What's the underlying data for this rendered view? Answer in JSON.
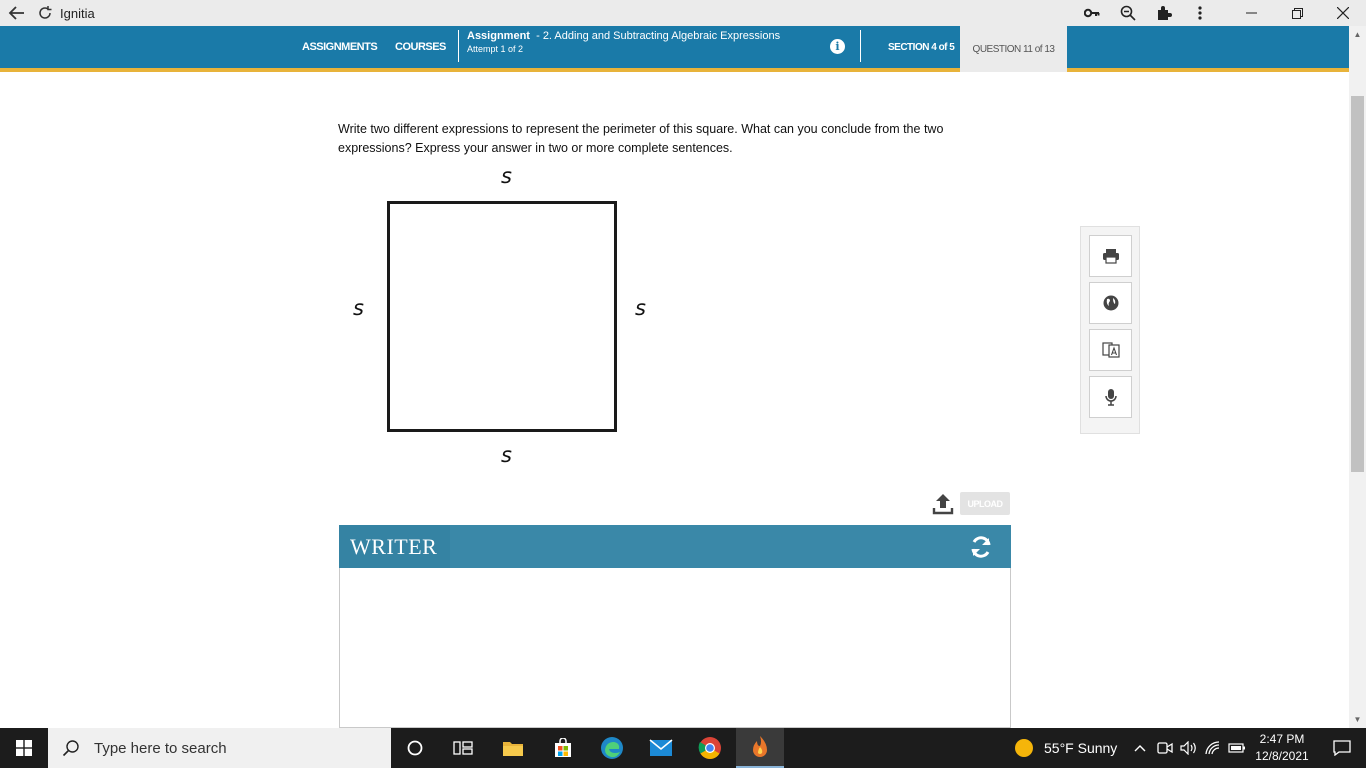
{
  "browser": {
    "title": "Ignitia",
    "icons": [
      "back-arrow-icon",
      "refresh-icon",
      "key-icon",
      "zoom-icon",
      "extensions-icon",
      "more-vert-icon",
      "minimize-icon",
      "restore-icon",
      "close-icon"
    ]
  },
  "header": {
    "nav": [
      "ASSIGNMENTS",
      "COURSES"
    ],
    "assignment_label": "Assignment",
    "assignment_title": "- 2. Adding and Subtracting Algebraic Expressions",
    "attempt": "Attempt 1 of 2",
    "section": "SECTION 4 of 5",
    "question": "QUESTION 11 of 13"
  },
  "question": {
    "text": "Write two different expressions to represent the perimeter of this square. What can you conclude from the two expressions? Express your answer in two or more complete sentences.",
    "square_labels": {
      "top": "s",
      "left": "s",
      "right": "s",
      "bottom": "s"
    }
  },
  "tools": [
    "print-icon",
    "globe-icon",
    "translate-icon",
    "microphone-icon"
  ],
  "upload": {
    "label": "UPLOAD"
  },
  "writer": {
    "title": "WRITER"
  },
  "taskbar": {
    "search_placeholder": "Type here to search",
    "weather": "55°F  Sunny",
    "time": "2:47 PM",
    "date": "12/8/2021"
  },
  "colors": {
    "header": "#1a7aa8",
    "header_underline": "#e8b33a",
    "writer_header": "#3a88a8",
    "question_tab": "#ebebeb"
  }
}
